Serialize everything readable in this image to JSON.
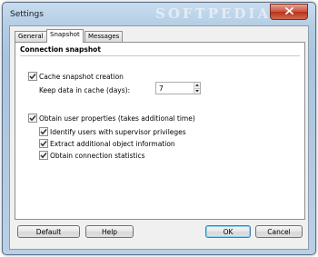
{
  "window": {
    "title": "Settings",
    "watermark": "SOFTPEDIA",
    "close_icon": "close-icon"
  },
  "tabs": [
    {
      "label": "General",
      "active": false
    },
    {
      "label": "Snapshot",
      "active": true
    },
    {
      "label": "Messages",
      "active": false
    }
  ],
  "snapshot": {
    "section_title": "Connection snapshot",
    "cache_snapshot": {
      "label": "Cache snapshot creation",
      "checked": true
    },
    "keep_days": {
      "label": "Keep data in cache (days):",
      "value": "7"
    },
    "obtain_properties": {
      "label": "Obtain user properties (takes additional time)",
      "checked": true
    },
    "identify_supervisors": {
      "label": "Identify users with supervisor privileges",
      "checked": true
    },
    "extract_info": {
      "label": "Extract additional object information",
      "checked": true
    },
    "connection_stats": {
      "label": "Obtain connection statistics",
      "checked": true
    }
  },
  "buttons": {
    "default": "Default",
    "help": "Help",
    "ok": "OK",
    "cancel": "Cancel"
  }
}
